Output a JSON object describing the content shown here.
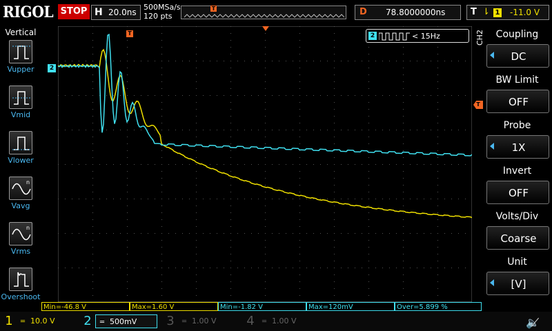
{
  "header": {
    "logo": "RIGOL",
    "run_state": "STOP",
    "timebase_label": "H",
    "timebase_value": "20.0ns",
    "sample_rate": "500MSa/s",
    "memory_points": "120 pts",
    "delay_label": "D",
    "delay_value": "78.8000000ns",
    "trigger_label": "T",
    "trigger_source": "1",
    "trigger_level": "-11.0 V"
  },
  "left_menu": {
    "title": "Vertical",
    "items": [
      {
        "label": "Vupper",
        "icon": "vupper-icon"
      },
      {
        "label": "Vmid",
        "icon": "vmid-icon"
      },
      {
        "label": "Vlower",
        "icon": "vlower-icon"
      },
      {
        "label": "Vavg",
        "icon": "vavg-icon"
      },
      {
        "label": "Vrms",
        "icon": "vrms-icon"
      },
      {
        "label": "Overshoot",
        "icon": "overshoot-icon"
      }
    ]
  },
  "right_menu": {
    "channel": "CH2",
    "items": [
      {
        "title": "Coupling",
        "value": "DC",
        "arrow": true
      },
      {
        "title": "BW Limit",
        "value": "OFF",
        "arrow": false
      },
      {
        "title": "Probe",
        "value": "1X",
        "arrow": true
      },
      {
        "title": "Invert",
        "value": "OFF",
        "arrow": false
      },
      {
        "title": "Volts/Div",
        "value": "Coarse",
        "arrow": false
      },
      {
        "title": "Unit",
        "value": "[V]",
        "arrow": true
      }
    ]
  },
  "screen": {
    "frequency_channel": "2",
    "frequency_value": "< 15Hz",
    "ch2_marker": "2",
    "trigger_marker": "T"
  },
  "measurements": [
    {
      "text": "Min=-46.8 V",
      "color": "yellow"
    },
    {
      "text": "Max=1.60 V",
      "color": "yellow"
    },
    {
      "text": "Min=-1.82 V",
      "color": "cyan"
    },
    {
      "text": "Max=120mV",
      "color": "cyan"
    },
    {
      "text": "Over=5.899 %",
      "color": "cyan"
    }
  ],
  "channels": [
    {
      "num": "1",
      "scale": "10.0 V",
      "color": "#f0e000",
      "active": true
    },
    {
      "num": "2",
      "scale": "500mV",
      "color": "#40e0f0",
      "active": true
    },
    {
      "num": "3",
      "scale": "1.00 V",
      "color": "#d020d0",
      "active": false
    },
    {
      "num": "4",
      "scale": "1.00 V",
      "color": "#2060ff",
      "active": false
    }
  ],
  "colors": {
    "ch1": "#f0e000",
    "ch2": "#40e0f0",
    "trigger": "#f26522",
    "menu_accent": "#4ab8f0"
  }
}
